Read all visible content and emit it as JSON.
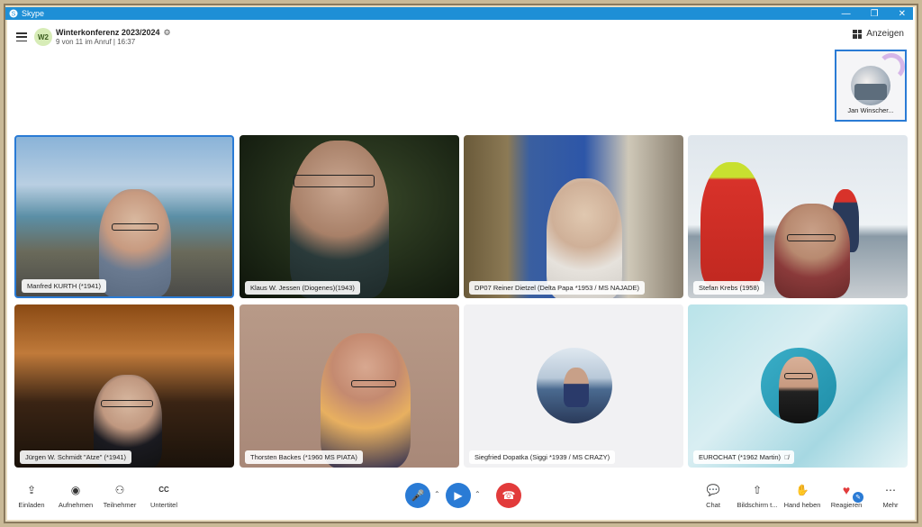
{
  "window": {
    "title": "Skype",
    "controls": {
      "minimize": "—",
      "maximize": "❐",
      "close": "✕"
    }
  },
  "header": {
    "avatar_text": "W2",
    "conference_title": "Winterkonferenz 2023/2024",
    "subtitle": "9 von 11 im Anruf | 16:37",
    "view_label": "Anzeigen"
  },
  "self_view": {
    "name": "Jan Winscher..."
  },
  "participants": [
    {
      "name": "Manfred KURTH (*1941)",
      "active": true
    },
    {
      "name": "Klaus W. Jessen (Diogenes)(1943)"
    },
    {
      "name": "DP07 Reiner Dietzel (Delta Papa *1953 / MS NAJADE)"
    },
    {
      "name": "Stefan Krebs (1958)"
    },
    {
      "name": "Jürgen W. Schmidt \"Atze\" (*1941)"
    },
    {
      "name": "Thorsten Backes (*1960 MS PIATA)"
    },
    {
      "name": "Siegfried Dopatka (Siggi *1939 / MS CRAZY)"
    },
    {
      "name": "EUROCHAT (*1962 Martin)",
      "muted": true
    }
  ],
  "toolbar": {
    "left": [
      "Einladen",
      "Aufnehmen",
      "Teilnehmer",
      "Untertitel"
    ],
    "right": [
      "Chat",
      "Bildschirm t...",
      "Hand heben",
      "Reagieren",
      "Mehr"
    ],
    "icons": {
      "invite": "⇪",
      "record": "◉",
      "participants": "⚇",
      "subtitles": "CC",
      "chat": "💬",
      "share": "⇧",
      "hand": "✋",
      "react": "♥",
      "more": "⋯",
      "mic": "🎤",
      "video": "▶",
      "hangup": "☎"
    }
  },
  "colors": {
    "accent": "#2a7bd5",
    "hangup": "#e23b3b",
    "react": "#e23b3b",
    "titlebar": "#1e8fd6"
  }
}
